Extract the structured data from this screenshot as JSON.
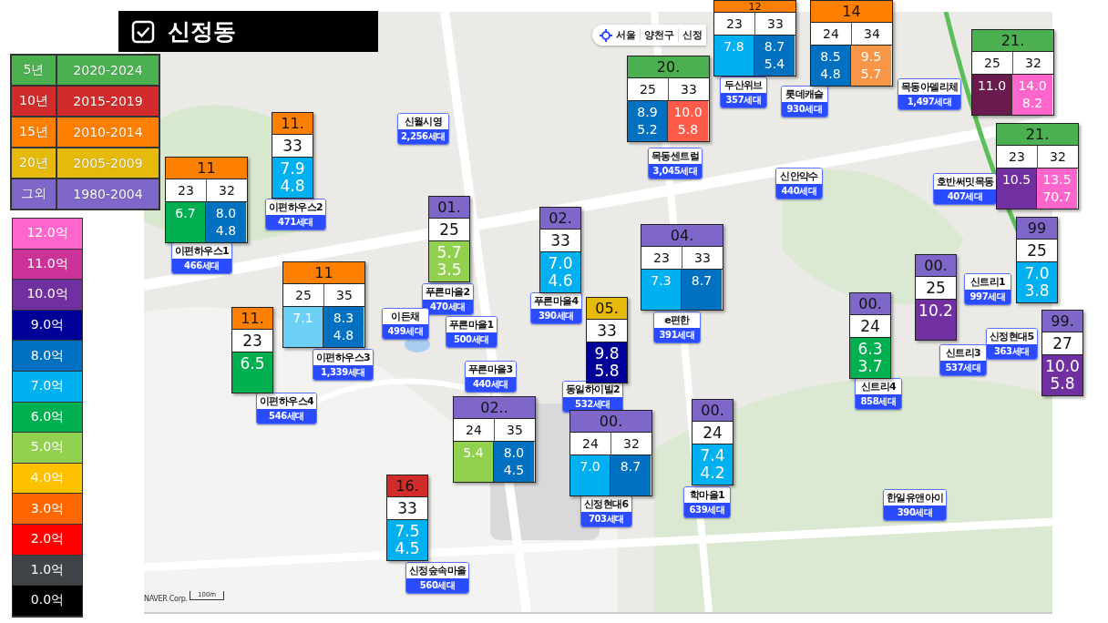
{
  "title": {
    "text": "신정동",
    "checked": true
  },
  "era_legend": [
    {
      "label": "5년",
      "range": "2020-2024",
      "color": "#4caf50"
    },
    {
      "label": "10년",
      "range": "2015-2019",
      "color": "#d12b2b"
    },
    {
      "label": "15년",
      "range": "2010-2014",
      "color": "#ff8000"
    },
    {
      "label": "20년",
      "range": "2005-2009",
      "color": "#e6b90d"
    },
    {
      "label": "그외",
      "range": "1980-2004",
      "color": "#7f66c9"
    }
  ],
  "price_legend": [
    {
      "label": "12.0억",
      "color": "#ff66cc"
    },
    {
      "label": "11.0억",
      "color": "#cc3399"
    },
    {
      "label": "10.0억",
      "color": "#7030a0"
    },
    {
      "label": "9.0억",
      "color": "#000099"
    },
    {
      "label": "8.0억",
      "color": "#0070c0"
    },
    {
      "label": "7.0억",
      "color": "#00b0f0"
    },
    {
      "label": "6.0억",
      "color": "#00b050"
    },
    {
      "label": "5.0억",
      "color": "#92d050"
    },
    {
      "label": "4.0억",
      "color": "#ffc000"
    },
    {
      "label": "3.0억",
      "color": "#ff6600"
    },
    {
      "label": "2.0억",
      "color": "#ff0000"
    },
    {
      "label": "1.0억",
      "color": "#404449"
    },
    {
      "label": "0.0억",
      "color": "#000000"
    }
  ],
  "breadcrumb": [
    "서울",
    "양천구",
    "신정"
  ],
  "markers": [
    {
      "name": "두산위브",
      "households": "357세대"
    },
    {
      "name": "목동아델리체",
      "households": "1,497세대"
    },
    {
      "name": "롯데캐슬",
      "households": "930세대"
    },
    {
      "name": "신월시영",
      "households": "2,256세대"
    },
    {
      "name": "목동센트럴",
      "households": "3,045세대"
    },
    {
      "name": "신안약수",
      "households": "440세대"
    },
    {
      "name": "호반써밋목동",
      "households": "407세대"
    },
    {
      "name": "이편하우스2",
      "households": "471세대"
    },
    {
      "name": "이편하우스1",
      "households": "466세대"
    },
    {
      "name": "신트리1",
      "households": "997세대"
    },
    {
      "name": "푸른마을2",
      "households": "470세대"
    },
    {
      "name": "푸른마을4",
      "households": "390세대"
    },
    {
      "name": "이든채",
      "households": "499세대"
    },
    {
      "name": "e편한",
      "households": "391세대"
    },
    {
      "name": "푸른마을1",
      "households": "500세대"
    },
    {
      "name": "신정현대5",
      "households": "363세대"
    },
    {
      "name": "신트리3",
      "households": "537세대"
    },
    {
      "name": "이편하우스3",
      "households": "1,339세대"
    },
    {
      "name": "푸른마을3",
      "households": "440세대"
    },
    {
      "name": "동일하이빌2",
      "households": "532세대"
    },
    {
      "name": "신트리4",
      "households": "858세대"
    },
    {
      "name": "이편하우스4",
      "households": "546세대"
    },
    {
      "name": "학마을1",
      "households": "639세대"
    },
    {
      "name": "한일유앤아이",
      "households": "390세대"
    },
    {
      "name": "신정현대6",
      "households": "703세대"
    },
    {
      "name": "신정숲속마을",
      "households": "560세대"
    }
  ],
  "cards": [
    {
      "year": "11",
      "color": "#ff8000",
      "units": [
        {
          "size": "23",
          "color": "#00b050",
          "prices": [
            "6.7"
          ]
        },
        {
          "size": "32",
          "color": "#0070c0",
          "prices": [
            "8.0",
            "4.8"
          ]
        }
      ]
    },
    {
      "year": "11.",
      "color": "#ff8000",
      "units": [
        {
          "size": "33",
          "color": "#00b0f0",
          "prices": [
            "7.9",
            "4.8"
          ]
        }
      ]
    },
    {
      "year": "11",
      "color": "#ff8000",
      "units": [
        {
          "size": "25",
          "color": "#6dd0f7",
          "prices": [
            "7.1"
          ]
        },
        {
          "size": "35",
          "color": "#0070c0",
          "prices": [
            "8.3",
            "4.8"
          ]
        }
      ]
    },
    {
      "year": "11.",
      "color": "#ff8000",
      "units": [
        {
          "size": "23",
          "color": "#00b050",
          "prices": [
            "6.5"
          ]
        }
      ]
    },
    {
      "year": "01.",
      "color": "#7f66c9",
      "units": [
        {
          "size": "25",
          "color": "#92d050",
          "prices": [
            "5.7",
            "3.5"
          ]
        }
      ]
    },
    {
      "year": "02.",
      "color": "#7f66c9",
      "units": [
        {
          "size": "33",
          "color": "#00b0f0",
          "prices": [
            "7.0",
            "4.6"
          ]
        }
      ]
    },
    {
      "year": "04.",
      "color": "#7f66c9",
      "units": [
        {
          "size": "23",
          "color": "#00b0f0",
          "prices": [
            "7.3"
          ]
        },
        {
          "size": "33",
          "color": "#0070c0",
          "prices": [
            "8.7"
          ]
        }
      ]
    },
    {
      "year": "05.",
      "color": "#e6b90d",
      "units": [
        {
          "size": "33",
          "color": "#000099",
          "prices": [
            "9.8",
            "5.8"
          ]
        }
      ]
    },
    {
      "year": "02..",
      "color": "#7f66c9",
      "units": [
        {
          "size": "24",
          "color": "#92d050",
          "prices": [
            "5.4"
          ]
        },
        {
          "size": "35",
          "color": "#0070c0",
          "prices": [
            "8.0",
            "4.5"
          ]
        }
      ]
    },
    {
      "year": "00.",
      "color": "#7f66c9",
      "units": [
        {
          "size": "24",
          "color": "#00b0f0",
          "prices": [
            "7.0"
          ]
        },
        {
          "size": "32",
          "color": "#0070c0",
          "prices": [
            "8.7"
          ]
        }
      ]
    },
    {
      "year": "00.",
      "color": "#7f66c9",
      "units": [
        {
          "size": "24",
          "color": "#00b0f0",
          "prices": [
            "7.4",
            "4.2"
          ]
        }
      ]
    },
    {
      "year": "16.",
      "color": "#d12b2b",
      "units": [
        {
          "size": "33",
          "color": "#00b0f0",
          "prices": [
            "7.5",
            "4.5"
          ]
        }
      ]
    },
    {
      "year": "20.",
      "color": "#4caf50",
      "units": [
        {
          "size": "25",
          "color": "#0070c0",
          "prices": [
            "8.9",
            "5.2"
          ]
        },
        {
          "size": "33",
          "color": "#ff5b4a",
          "prices": [
            "10.0",
            "5.8"
          ]
        }
      ]
    },
    {
      "year": "12",
      "color": "#ff8000",
      "units": [
        {
          "size": "23",
          "color": "#00b0f0",
          "prices": [
            "7.8"
          ]
        },
        {
          "size": "33",
          "color": "#0070c0",
          "prices": [
            "8.7",
            "5.4"
          ]
        }
      ]
    },
    {
      "year": "14",
      "color": "#ff8000",
      "units": [
        {
          "size": "24",
          "color": "#0070c0",
          "prices": [
            "8.5",
            "4.8"
          ]
        },
        {
          "size": "34",
          "color": "#f79646",
          "prices": [
            "9.5",
            "5.7"
          ]
        }
      ]
    },
    {
      "year": "21.",
      "color": "#4caf50",
      "units": [
        {
          "size": "25",
          "color": "#6b1a4e",
          "prices": [
            "11.0"
          ]
        },
        {
          "size": "32",
          "color": "#ff66cc",
          "prices": [
            "14.0",
            "8.2"
          ]
        }
      ]
    },
    {
      "year": "21.",
      "color": "#4caf50",
      "units": [
        {
          "size": "23",
          "color": "#7030a0",
          "prices": [
            "10.5"
          ]
        },
        {
          "size": "32",
          "color": "#ff66cc",
          "prices": [
            "13.5",
            "70.7"
          ]
        }
      ]
    },
    {
      "year": "99",
      "color": "#7f66c9",
      "units": [
        {
          "size": "25",
          "color": "#00b0f0",
          "prices": [
            "7.0",
            "3.8"
          ]
        }
      ]
    },
    {
      "year": "00.",
      "color": "#7f66c9",
      "units": [
        {
          "size": "25",
          "color": "#7030a0",
          "prices": [
            "10.2"
          ]
        }
      ]
    },
    {
      "year": "00.",
      "color": "#7f66c9",
      "units": [
        {
          "size": "24",
          "color": "#00b050",
          "prices": [
            "6.3",
            "3.7"
          ]
        }
      ]
    },
    {
      "year": "99.",
      "color": "#7f66c9",
      "units": [
        {
          "size": "27",
          "color": "#7030a0",
          "prices": [
            "10.0",
            "5.8"
          ]
        }
      ]
    }
  ],
  "attribution": "NAVER Corp.",
  "scale": "100m"
}
